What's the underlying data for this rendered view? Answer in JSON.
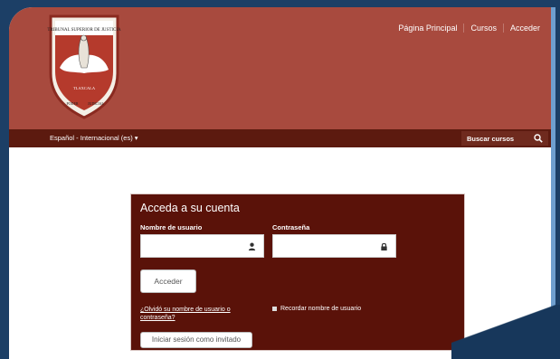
{
  "nav": {
    "items": [
      "Página Principal",
      "Cursos",
      "Acceder"
    ]
  },
  "logo": {
    "lines": [
      "TRIBUNAL SUPERIOR DE JUSTICIA",
      "TLAXCALA",
      "PODER",
      "JUDICIAL"
    ]
  },
  "langbar": {
    "language": "Español - Internacional (es) ▾",
    "search_placeholder": "Buscar cursos"
  },
  "login": {
    "title": "Acceda a su cuenta",
    "username_label": "Nombre de usuario",
    "password_label": "Contraseña",
    "username_value": "",
    "password_value": "",
    "submit_label": "Acceder",
    "forgot_label": "¿Olvidó su nombre de usuario o contraseña?",
    "remember_label": "Recordar nombre de usuario",
    "remember_checked": false,
    "guest_label": "Iniciar sesión como invitado"
  },
  "colors": {
    "header": "#a84a3e",
    "langbar": "#5c1a0f",
    "login_panel": "#5a1209"
  },
  "icons": {
    "user": "user-icon",
    "lock": "lock-icon",
    "search": "search-icon"
  }
}
